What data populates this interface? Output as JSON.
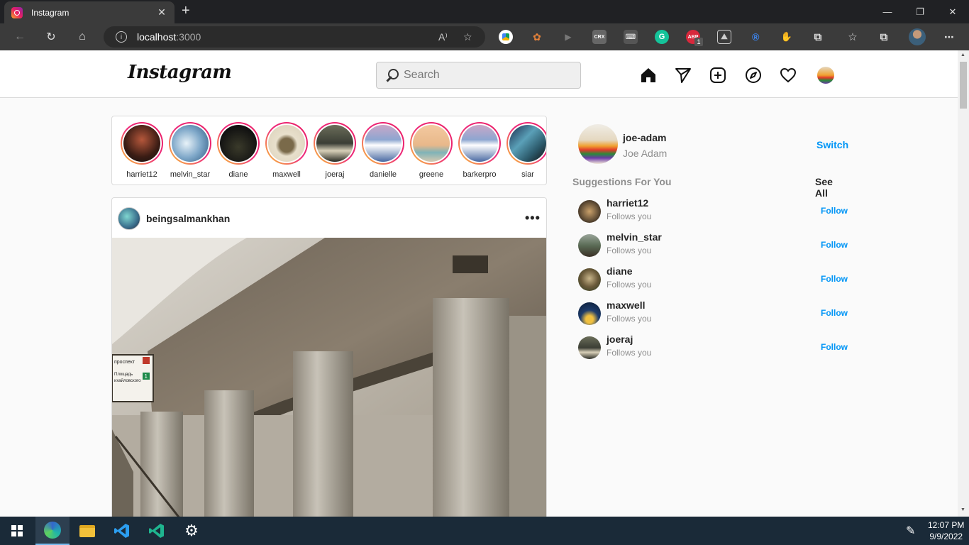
{
  "browser": {
    "tab_title": "Instagram",
    "new_tab_icon": "+",
    "url_host": "localhost",
    "url_port": ":3000",
    "extensions": [
      "drive-ext",
      "cookie-ext",
      "play-ext",
      "CRX",
      "keyboard-ext",
      "grammarly-ext",
      "ABP",
      "pdf-ext",
      "R",
      "hand-ext",
      "puzzle-ext"
    ],
    "abp_badge": "1"
  },
  "app": {
    "logo": "Instagram",
    "search": {
      "placeholder": "Search"
    }
  },
  "stories": [
    {
      "name": "harriet12",
      "color": "#3a1c14"
    },
    {
      "name": "melvin_star",
      "color": "#7fa8c9"
    },
    {
      "name": "diane",
      "color": "#1a1a1a"
    },
    {
      "name": "maxwell",
      "color": "#d9cfb8"
    },
    {
      "name": "joeraj",
      "color": "#3b3e35"
    },
    {
      "name": "danielle",
      "color": "#6f86b3"
    },
    {
      "name": "greene",
      "color": "#e8b88a"
    },
    {
      "name": "barkerpro",
      "color": "#6f86b3"
    },
    {
      "name": "siar",
      "color": "#2c5a6b"
    }
  ],
  "post": {
    "username": "beingsalmankhan",
    "more": "•••",
    "sign_lines": [
      "проспект",
      "Площадь",
      "ихайловского"
    ],
    "sign_numbers": [
      "1"
    ]
  },
  "sidebar": {
    "username": "joe-adam",
    "name": "Joe Adam",
    "switch_label": "Switch",
    "suggestions_title": "Suggestions For You",
    "see_all_label": "See All",
    "suggestions": [
      {
        "username": "harriet12",
        "subtitle": "Follows you",
        "action": "Follow",
        "color": "#4a3b2a"
      },
      {
        "username": "melvin_star",
        "subtitle": "Follows you",
        "action": "Follow",
        "color": "#5a6b55"
      },
      {
        "username": "diane",
        "subtitle": "Follows you",
        "action": "Follow",
        "color": "#6b5a3a"
      },
      {
        "username": "maxwell",
        "subtitle": "Follows you",
        "action": "Follow",
        "color": "#1e3c6b"
      },
      {
        "username": "joeraj",
        "subtitle": "Follows you",
        "action": "Follow",
        "color": "#3b3e35"
      }
    ]
  },
  "taskbar": {
    "time": "12:07 PM",
    "date": "9/9/2022"
  }
}
